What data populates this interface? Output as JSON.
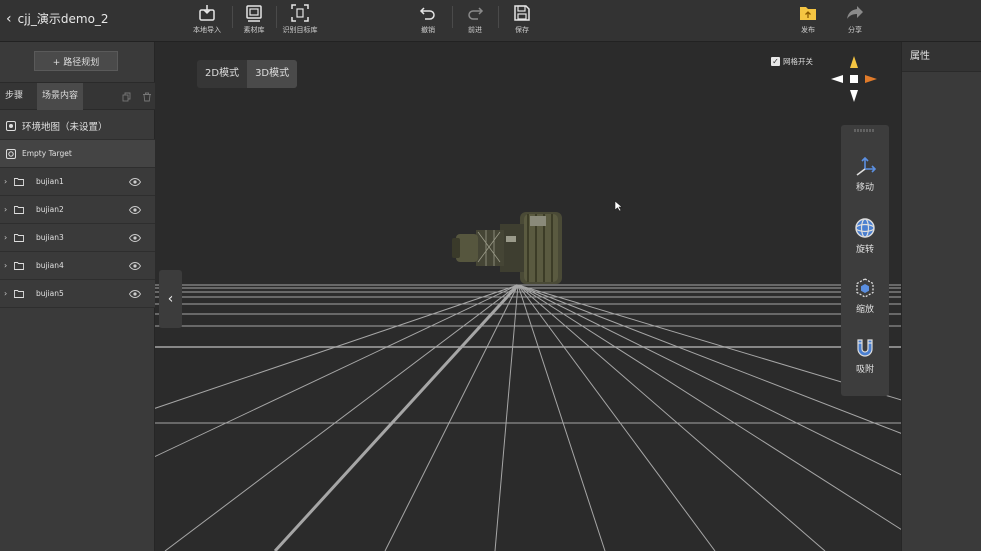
{
  "header": {
    "back_label": "cjj_演示demo_2",
    "tools_left": [
      {
        "label": "本地导入",
        "icon": "import-icon"
      },
      {
        "label": "素材库",
        "icon": "library-icon"
      },
      {
        "label": "识别目标库",
        "icon": "target-library-icon"
      }
    ],
    "tools_mid": [
      {
        "label": "撤销",
        "icon": "undo-icon"
      },
      {
        "label": "前进",
        "icon": "redo-icon"
      },
      {
        "label": "保存",
        "icon": "save-icon"
      }
    ],
    "tools_right": [
      {
        "label": "发布",
        "icon": "publish-icon"
      },
      {
        "label": "分享",
        "icon": "share-icon"
      }
    ]
  },
  "left_panel": {
    "route_button": "+ 路径规划",
    "tabs": [
      {
        "label": "步骤",
        "active": false
      },
      {
        "label": "场景内容",
        "active": true
      }
    ],
    "env_map": "环境地图（未设置）",
    "empty_target": "Empty Target",
    "items": [
      {
        "name": "bujian1"
      },
      {
        "name": "bujian2"
      },
      {
        "name": "bujian3"
      },
      {
        "name": "bujian4"
      },
      {
        "name": "bujian5"
      }
    ]
  },
  "viewport": {
    "modes": [
      {
        "label": "2D模式",
        "active": false
      },
      {
        "label": "3D模式",
        "active": true
      }
    ],
    "grid_toggle": {
      "label": "网格开关",
      "checked": true
    },
    "transform_tools": [
      {
        "label": "移动",
        "icon": "move-icon"
      },
      {
        "label": "旋转",
        "icon": "rotate-icon"
      },
      {
        "label": "缩放",
        "icon": "scale-icon"
      },
      {
        "label": "吸附",
        "icon": "magnet-icon"
      }
    ]
  },
  "right_panel": {
    "title": "属性"
  },
  "colors": {
    "background": "#2b2b2b",
    "panel": "#3a3a3a",
    "topbar": "#333333",
    "accent_yellow": "#f5c542",
    "gizmo_orange": "#e07b2a",
    "tool_blue": "#4a7fd0"
  }
}
